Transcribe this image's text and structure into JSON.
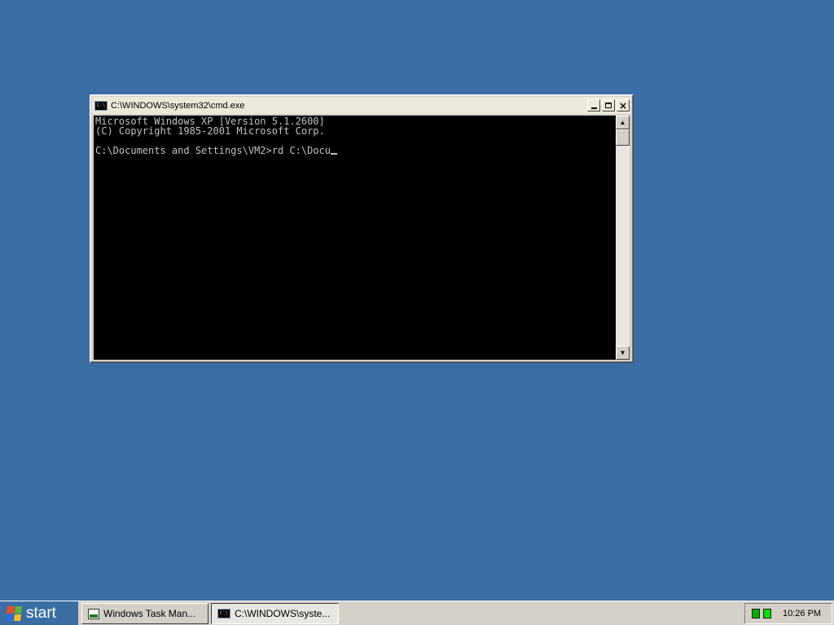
{
  "window": {
    "title": "C:\\WINDOWS\\system32\\cmd.exe",
    "icon": "cmd-icon",
    "icon_text": "C:\\",
    "buttons": {
      "minimize": "minimize-icon",
      "maximize": "maximize-icon",
      "close": "×"
    }
  },
  "console": {
    "lines": [
      "Microsoft Windows XP [Version 5.1.2600]",
      "(C) Copyright 1985-2001 Microsoft Corp.",
      "",
      "C:\\Documents and Settings\\VM2>rd C:\\Docu"
    ],
    "text_color": "#c0c0c0",
    "background": "#000000"
  },
  "scrollbar": {
    "up": "▲",
    "down": "▼"
  },
  "taskbar": {
    "start_label": "start",
    "tasks": [
      {
        "label": "Windows Task Man...",
        "icon": "task-manager-icon",
        "active": false
      },
      {
        "label": "C:\\WINDOWS\\syste...",
        "icon": "cmd-icon",
        "icon_text": "C:\\",
        "active": true
      }
    ],
    "clock": "10:26 PM"
  },
  "colors": {
    "desktop": "#3a6ea5",
    "taskbar": "#d4d0c8",
    "logo": [
      "#e8502a",
      "#5cb82e",
      "#2a6fe0",
      "#f7c21c"
    ]
  }
}
